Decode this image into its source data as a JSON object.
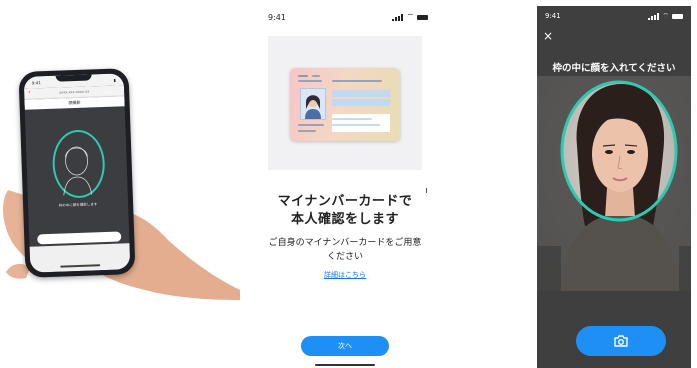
{
  "left_panel": {
    "phone": {
      "status_time": "9:41",
      "url_text": "xxxx.xxx.xxxx.xx",
      "back_icon": "chevron-left-icon",
      "page_title": "顔撮影",
      "hint_text": "枠の中に顔を撮影します",
      "button_label": ""
    }
  },
  "middle_panel": {
    "status_time": "9:41",
    "heading_line1": "マイナンバーカードで",
    "heading_line2": "本人確認をします",
    "description_line1": "ご自身のマイナンバーカードをご用意",
    "description_line2": "ください",
    "details_link": "詳細はこちら",
    "next_button": "次へ"
  },
  "right_panel": {
    "status_time": "9:41",
    "close_icon": "close-icon",
    "instruction": "枠の中に顔を入れてください",
    "shutter_icon": "camera-icon"
  },
  "colors": {
    "accent_blue": "#1e90f5",
    "frame_green": "#2ec9b1",
    "camera_bg": "#3f3f3f"
  }
}
